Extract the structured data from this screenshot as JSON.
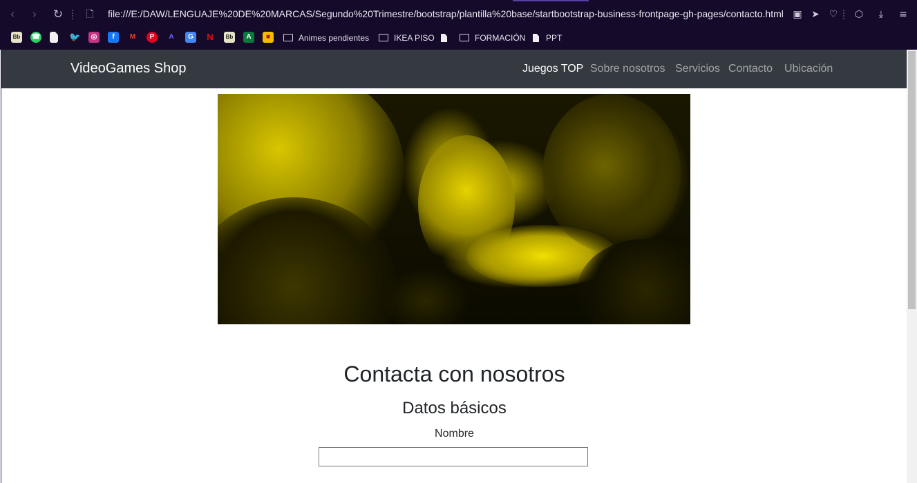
{
  "browser": {
    "url": "file:///E:/DAW/LENGUAJE%20DE%20MARCAS/Segundo%20Trimestre/bootstrap/plantilla%20base/startbootstrap-business-frontpage-gh-pages/contacto.html",
    "bookmarks": {
      "folder_1": "Animes pendientes",
      "folder_2": "IKEA PISO",
      "folder_3": "FORMACIÓN",
      "doc_1": "PPT"
    },
    "icon_colors": {
      "background": "#160a2a",
      "whatsapp": "#25d366",
      "twitter": "#1da1f2",
      "instagram": "#c13584",
      "facebook": "#1877f2",
      "pinterest": "#e60023",
      "netflix": "#e50914"
    }
  },
  "navbar": {
    "brand": "VideoGames Shop",
    "links": [
      "Juegos TOP",
      "Sobre nosotros",
      "Servicios",
      "Contacto",
      "Ubicación"
    ],
    "active_index": 0,
    "background": "#343a40"
  },
  "hero": {
    "tint": "#e8d100"
  },
  "contact": {
    "title": "Contacta con nosotros",
    "subtitle": "Datos básicos",
    "name_label": "Nombre",
    "name_value": ""
  }
}
